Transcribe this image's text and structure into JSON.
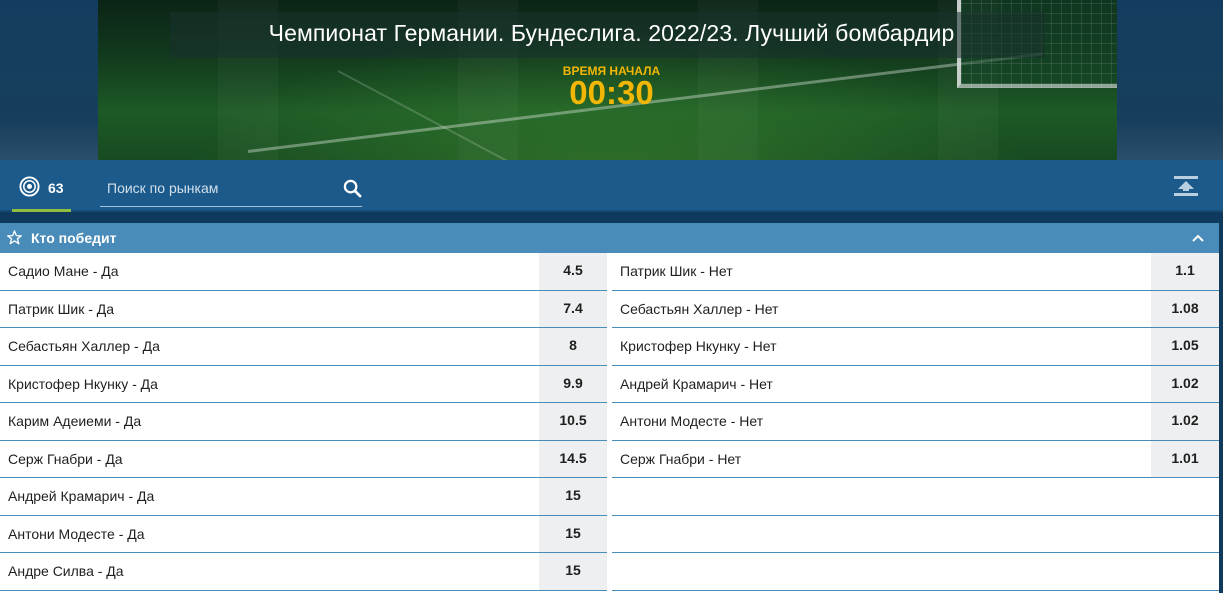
{
  "event": {
    "title": "Чемпионат Германии. Бундеслига. 2022/23. Лучший бомбардир",
    "start_label": "ВРЕМЯ НАЧАЛА",
    "start_time": "00:30"
  },
  "toolbar": {
    "markets_count": "63",
    "search_placeholder": "Поиск по рынкам",
    "icons": {
      "markets": "target-icon",
      "search": "search-icon",
      "collapse": "collapse-all-icon"
    }
  },
  "market": {
    "title": "Кто победит",
    "icons": {
      "favorite": "star-icon",
      "toggle": "chevron-up-icon"
    },
    "left": [
      {
        "label": "Садио Мане - Да",
        "odd": "4.5"
      },
      {
        "label": "Патрик Шик - Да",
        "odd": "7.4"
      },
      {
        "label": "Себастьян Халлер - Да",
        "odd": "8"
      },
      {
        "label": "Кристофер Нкунку - Да",
        "odd": "9.9"
      },
      {
        "label": "Карим Адеиеми - Да",
        "odd": "10.5"
      },
      {
        "label": "Серж Гнабри - Да",
        "odd": "14.5"
      },
      {
        "label": "Андрей Крамарич - Да",
        "odd": "15"
      },
      {
        "label": "Антони Модесте - Да",
        "odd": "15"
      },
      {
        "label": "Андре Силва - Да",
        "odd": "15"
      }
    ],
    "right": [
      {
        "label": "Патрик Шик - Нет",
        "odd": "1.1"
      },
      {
        "label": "Себастьян Халлер - Нет",
        "odd": "1.08"
      },
      {
        "label": "Кристофер Нкунку - Нет",
        "odd": "1.05"
      },
      {
        "label": "Андрей Крамарич - Нет",
        "odd": "1.02"
      },
      {
        "label": "Антони Модесте - Нет",
        "odd": "1.02"
      },
      {
        "label": "Серж Гнабри - Нет",
        "odd": "1.01"
      }
    ]
  },
  "colors": {
    "accent_gold": "#f2b705",
    "toolbar_blue": "#1b5a8a",
    "market_header_blue": "#4a8cb9",
    "active_tab_green": "#8fbf3c"
  }
}
